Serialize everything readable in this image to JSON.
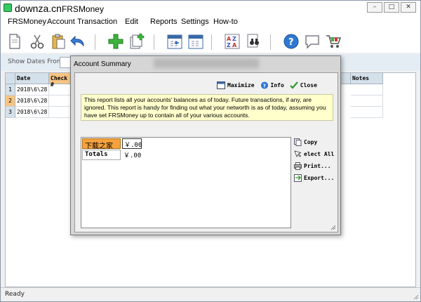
{
  "window": {
    "watermark": "downza.cn",
    "title": "FRSMoney",
    "controls": [
      "–",
      "□",
      "✕"
    ]
  },
  "menu": [
    "FRSMoney",
    "Account",
    "Transaction",
    "Edit",
    "Reports",
    "Settings",
    "How-to"
  ],
  "toolbar": {
    "icons": [
      "new-doc-icon",
      "cut-icon",
      "paste-icon",
      "undo-icon",
      "add-icon",
      "add-page-icon",
      "calendar-prev-icon",
      "calendar-next-icon",
      "sort-az-icon",
      "find-icon",
      "help-icon",
      "comment-icon",
      "cart-icon"
    ]
  },
  "filter": {
    "label": "Show Dates From:"
  },
  "grid": {
    "headers": {
      "date": "Date",
      "check": "Check #",
      "notes": "Notes"
    },
    "rows": [
      {
        "num": "1",
        "date": "2018\\6\\28"
      },
      {
        "num": "2",
        "date": "2018\\6\\28"
      },
      {
        "num": "3",
        "date": "2018\\6\\28"
      }
    ]
  },
  "status": {
    "text": "Ready"
  },
  "dialog": {
    "title": "Account Summary",
    "buttons": {
      "maximize": "Maximize",
      "info": "Info",
      "close": "Close"
    },
    "description": "This report lists all your accounts' balances as of today. Future transactions, if any, are ignored. This report is handy for finding out what your networth is as of today, assuming you have set FRSMoney up to contain all of your various accounts.",
    "accounts": [
      {
        "name": "下载之家",
        "value": "￥.00"
      }
    ],
    "totals": {
      "label": "Totals",
      "value": "￥.00"
    },
    "side_buttons": {
      "copy": "Copy",
      "select_all": "elect All",
      "print": "Print...",
      "export": "Export..."
    }
  }
}
